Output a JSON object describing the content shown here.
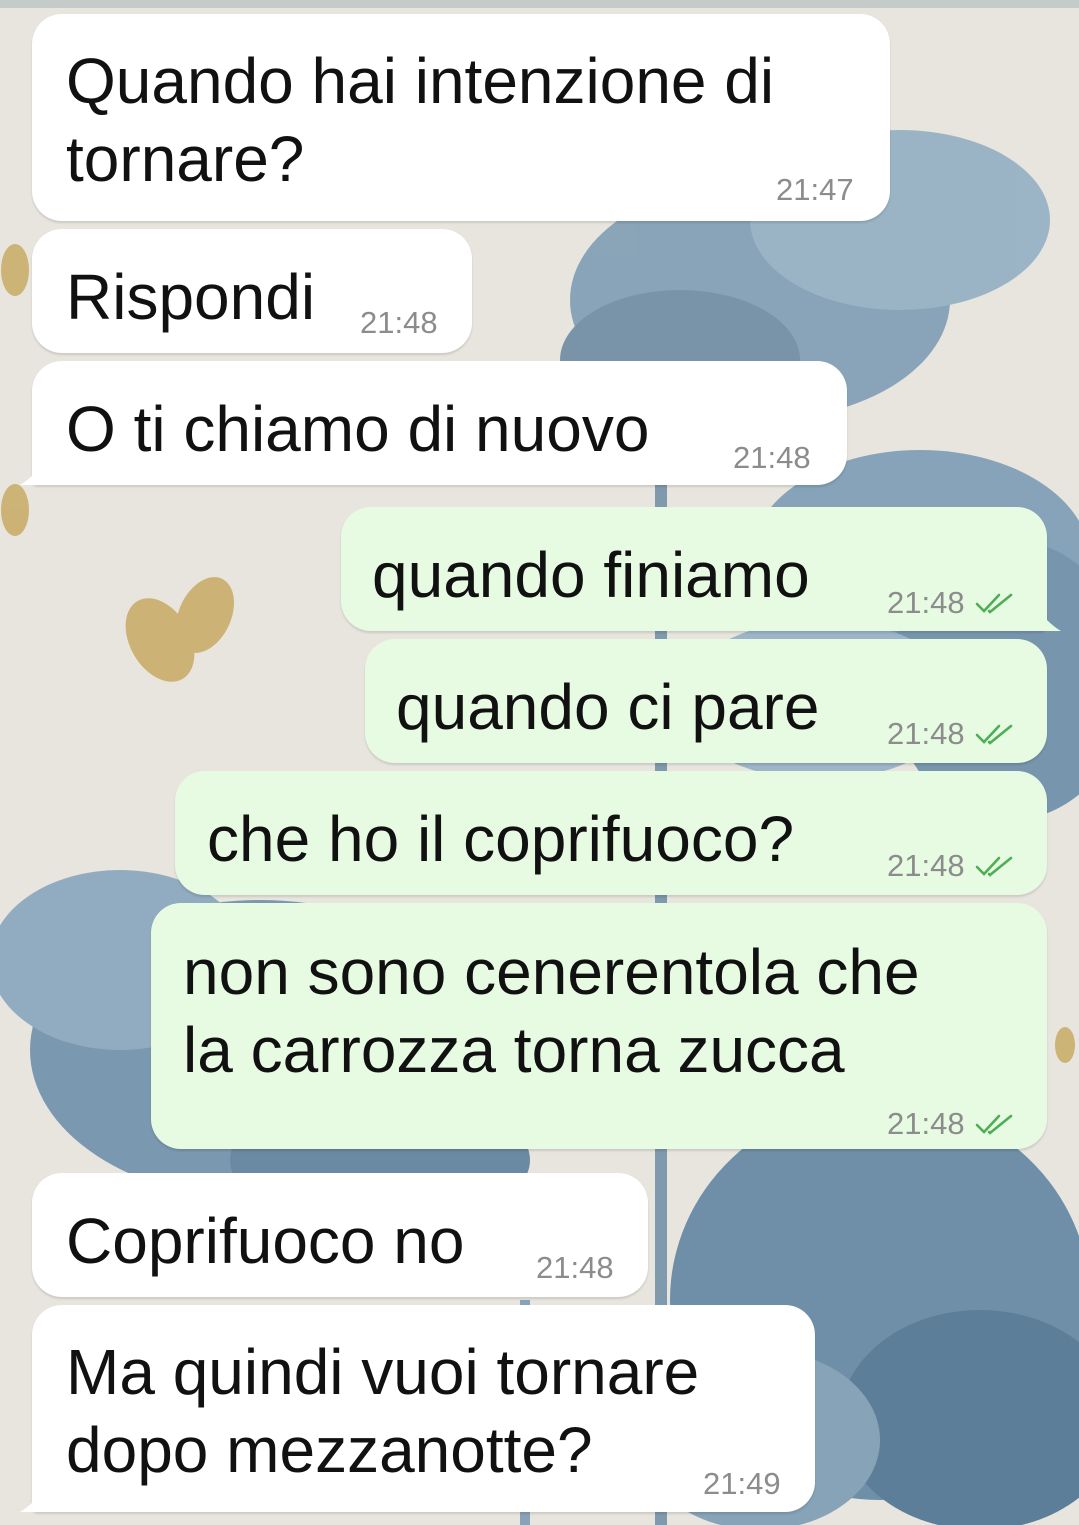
{
  "colors": {
    "incoming": "#ffffff",
    "outgoing": "#e7fbe3",
    "read_tick": "#4fae55",
    "time": "#8c8c8c"
  },
  "messages": [
    {
      "dir": "in",
      "text": "Quando hai intenzione di\ntornare?",
      "time": "21:47"
    },
    {
      "dir": "in",
      "text": "Rispondi",
      "time": "21:48"
    },
    {
      "dir": "in",
      "text": "O ti chiamo di nuovo",
      "time": "21:48"
    },
    {
      "dir": "out",
      "text": "quando finiamo",
      "time": "21:48",
      "status": "read-ticks-icon"
    },
    {
      "dir": "out",
      "text": "quando ci pare",
      "time": "21:48",
      "status": "read-ticks-icon"
    },
    {
      "dir": "out",
      "text": "che ho il coprifuoco?",
      "time": "21:48",
      "status": "read-ticks-icon"
    },
    {
      "dir": "out",
      "text": "non sono cenerentola che\nla carrozza torna zucca",
      "time": "21:48",
      "status": "read-ticks-icon"
    },
    {
      "dir": "in",
      "text": "Coprifuoco no",
      "time": "21:48"
    },
    {
      "dir": "in",
      "text": "Ma quindi vuoi tornare\ndopo mezzanotte?",
      "time": "21:49"
    }
  ]
}
